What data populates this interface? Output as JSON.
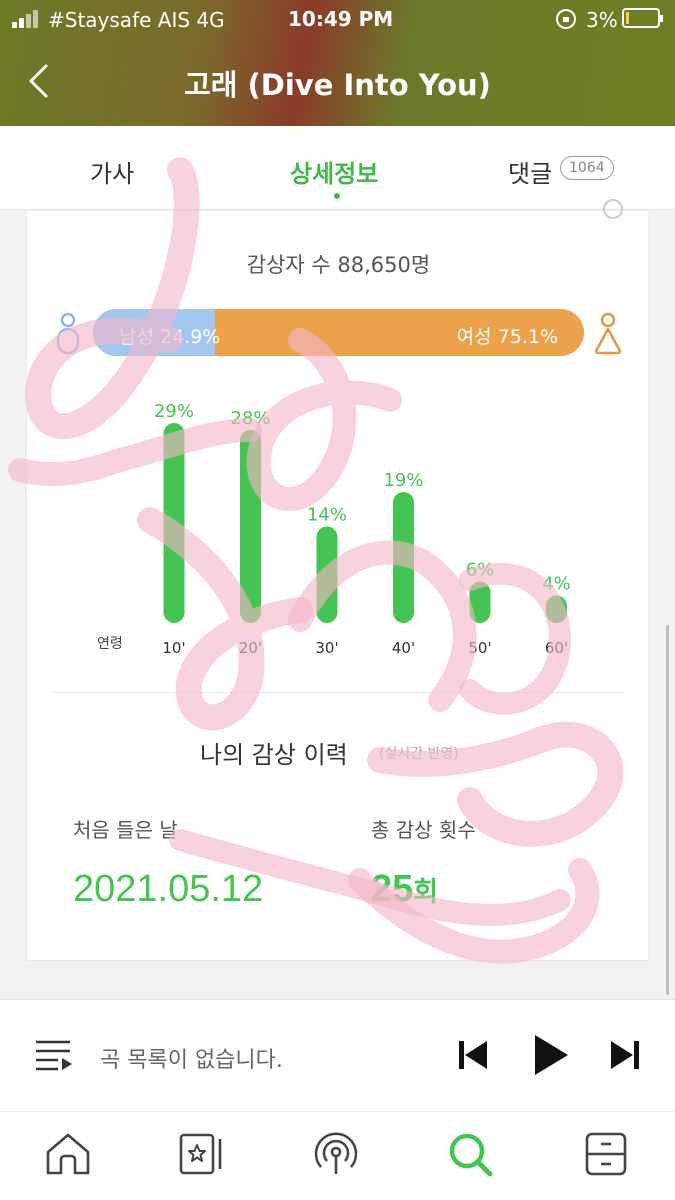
{
  "status_bar": {
    "carrier": "#Staysafe AIS  4G",
    "time": "10:49 PM",
    "battery": "3%"
  },
  "header": {
    "title": "고래 (Dive Into You)"
  },
  "tabs": [
    {
      "label": "가사",
      "active": false
    },
    {
      "label": "상세정보",
      "active": true
    },
    {
      "label": "댓글",
      "active": false,
      "badge": "1064"
    }
  ],
  "stats": {
    "listeners_text": "감상자 수 88,650명",
    "male_label": "남성 24.9%",
    "female_label": "여성 75.1%",
    "male_share": 24.9,
    "female_share": 75.1,
    "age_title": "연령"
  },
  "chart_data": {
    "type": "bar",
    "categories": [
      "10'",
      "20'",
      "30'",
      "40'",
      "50'",
      "60'"
    ],
    "values": [
      29,
      28,
      14,
      19,
      6,
      4
    ],
    "labels": [
      "29%",
      "28%",
      "14%",
      "19%",
      "6%",
      "4%"
    ],
    "xlabel": "연령"
  },
  "history": {
    "title": "나의 감상 이력",
    "subtitle": "(실시간 반영)",
    "first_listen_label": "처음 들은 날",
    "first_listen_date": "2021.05.12",
    "total_plays_label": "총 감상 횟수",
    "total_plays_value": "25",
    "total_plays_unit": "회"
  },
  "player": {
    "message": "곡 목록이 없습니다."
  },
  "bottom_nav": [
    "home-icon",
    "library-icon",
    "station-icon",
    "search-icon",
    "more-icon"
  ],
  "colors": {
    "accent": "#45c453",
    "male": "#a4c7f0",
    "female": "#eba24a",
    "watermark": "#f7c5d4"
  }
}
